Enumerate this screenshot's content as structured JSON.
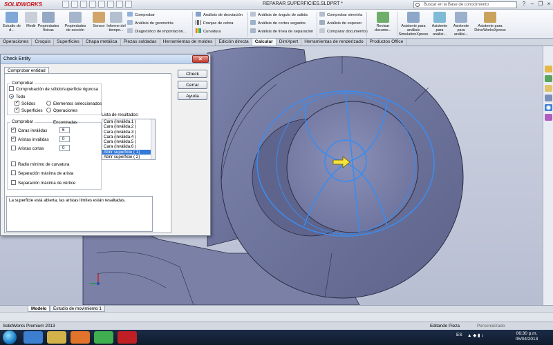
{
  "app": {
    "logo": "SOLIDWORKS",
    "document_title": "REPARAR SUPERFICIES.SLDPRT *",
    "search_placeholder": "Buscar en la Base de conocimiento"
  },
  "ribbon": {
    "large_buttons": [
      {
        "label": "Estudio de d...",
        "icon": "study-icon"
      },
      {
        "label": "Medir",
        "icon": "measure-icon"
      },
      {
        "label": "Propiedades físicas",
        "icon": "mass-properties-icon"
      },
      {
        "label": "Propiedades de sección",
        "icon": "section-properties-icon"
      },
      {
        "label": "Sensor",
        "icon": "sensor-icon"
      },
      {
        "label": "Informe del tiempo...",
        "icon": "report-icon"
      }
    ],
    "col1": [
      "Comprobar",
      "Análisis de geometría",
      "Diagnóstico de importación..."
    ],
    "col2": [
      "Análisis de desviación",
      "Franjas de cebra",
      "Curvatura"
    ],
    "col3": [
      "Análisis de ángulo de salida",
      "Análisis de cortes segados",
      "Análisis de línea de separación"
    ],
    "col4": [
      "Comprobar simetría",
      "Análisis de espesor",
      "Comparar documentos"
    ],
    "revisar": "Revisar docume...",
    "assistants": [
      "Asistente para análisis SimulationXpress",
      "Asistente para análisi...",
      "Asistente para análisi...",
      "Asistente para DriveWorksXpress"
    ]
  },
  "tabs": [
    "Operaciones",
    "Croquis",
    "Superficies",
    "Chapa metálica",
    "Piezas soldadas",
    "Herramientas de moldes",
    "Edición directa",
    "Calcular",
    "DimXpert",
    "Herramientas de renderizado",
    "Productos Office"
  ],
  "active_tab": "Calcular",
  "dialog": {
    "title": "Check Entity",
    "close": "×",
    "tab": "Comprobar entidad",
    "group1_label": "Comprobar",
    "chk_rigorous": "Comprobación de sólido/superficie rigurosa",
    "radio_all": "Todo",
    "chk_solids": "Sólidos",
    "chk_surfaces": "Superficies",
    "radio_selected": "Elementos seleccionados",
    "radio_operations": "Operaciones",
    "group2_label": "Comprobar",
    "found_header": "Encontradas",
    "chk_invalid_faces": "Caras inválidas",
    "val_invalid_faces": "6",
    "chk_invalid_edges": "Aristas inválidas",
    "val_invalid_edges": "0",
    "chk_short_edges": "Aristas cortas",
    "val_short_edges": "0",
    "chk_min_curv": "Radio mínimo de curvatura",
    "chk_max_edge_gap": "Separación máxima de arista",
    "chk_max_vertex_gap": "Separación máxima de vértice",
    "results_label": "Lista de resultados:",
    "results": [
      "Cara (inválida.1 )",
      "Cara (inválida.2 )",
      "Cara (inválida.3 )",
      "Cara (inválida.4 )",
      "Cara (inválida.5 )",
      "Cara (inválida.6 )",
      "Abrir superficie ( 1)",
      "Abrir superficie ( 2)"
    ],
    "selected_result": "Abrir superficie ( 1)",
    "message": "La superficie está abierta, las aristas límites están resaltadas.",
    "btn_check": "Check",
    "btn_close": "Cerrar",
    "btn_help": "Ayuda"
  },
  "bottom_tabs": [
    "Modelo",
    "Estudio de movimiento 1"
  ],
  "status": {
    "product": "SolidWorks Premium 2013",
    "mode": "Editando Pieza",
    "custom": "Personalizado"
  },
  "taskbar": {
    "lang": "ES",
    "time": "06:30 p.m.",
    "date": "05/04/2013"
  }
}
